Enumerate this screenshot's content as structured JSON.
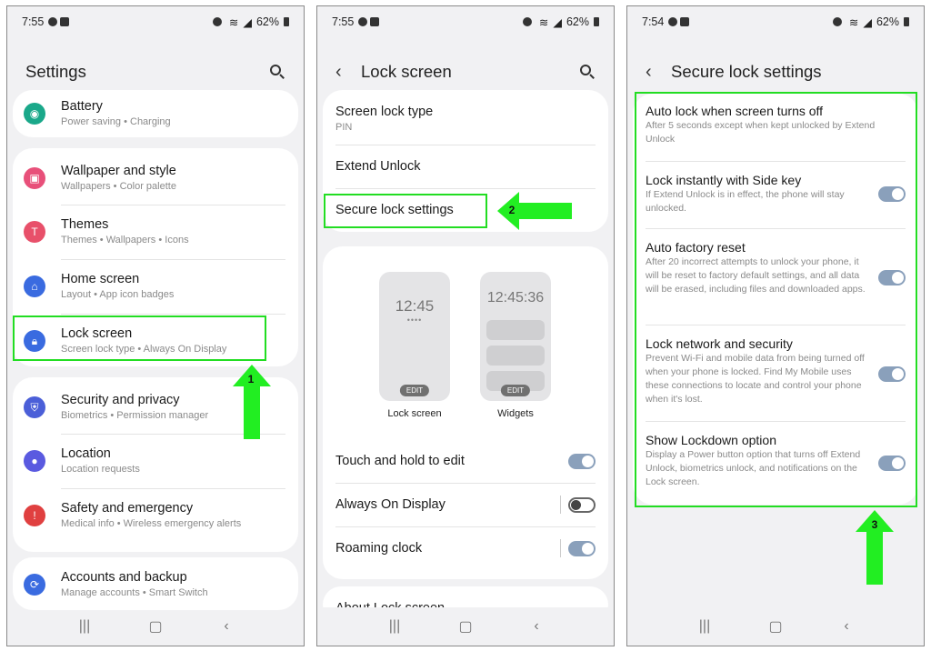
{
  "screens": [
    {
      "time": "7:55",
      "battery": "62%",
      "title": "Settings",
      "items": [
        {
          "title": "Battery",
          "sub": "Power saving  •  Charging"
        },
        {
          "title": "Wallpaper and style",
          "sub": "Wallpapers  •  Color palette"
        },
        {
          "title": "Themes",
          "sub": "Themes  •  Wallpapers  •  Icons"
        },
        {
          "title": "Home screen",
          "sub": "Layout  •  App icon badges"
        },
        {
          "title": "Lock screen",
          "sub": "Screen lock type  •  Always On Display"
        },
        {
          "title": "Security and privacy",
          "sub": "Biometrics  •  Permission manager"
        },
        {
          "title": "Location",
          "sub": "Location requests"
        },
        {
          "title": "Safety and emergency",
          "sub": "Medical info  •  Wireless emergency alerts"
        },
        {
          "title": "Accounts and backup",
          "sub": "Manage accounts  •  Smart Switch"
        }
      ],
      "step": "1"
    },
    {
      "time": "7:55",
      "battery": "62%",
      "title": "Lock screen",
      "screen_lock_type": "Screen lock type",
      "screen_lock_value": "PIN",
      "extend_unlock": "Extend Unlock",
      "secure_lock": "Secure lock settings",
      "preview_clock1": "12:45",
      "preview_dots": "••••",
      "preview_clock2": "12:45:36",
      "edit": "EDIT",
      "preview_label1": "Lock screen",
      "preview_label2": "Widgets",
      "touch_hold": "Touch and hold to edit",
      "aod": "Always On Display",
      "roaming": "Roaming clock",
      "about": "About Lock screen",
      "step": "2"
    },
    {
      "time": "7:54",
      "battery": "62%",
      "title": "Secure lock settings",
      "items": [
        {
          "title": "Auto lock when screen turns off",
          "sub": "After 5 seconds except when kept unlocked by Extend Unlock"
        },
        {
          "title": "Lock instantly with Side key",
          "sub": "If Extend Unlock is in effect, the phone will stay unlocked."
        },
        {
          "title": "Auto factory reset",
          "sub": "After 20 incorrect attempts to unlock your phone, it will be reset to factory default settings, and all data will be erased, including files and downloaded apps."
        },
        {
          "title": "Lock network and security",
          "sub": "Prevent Wi-Fi and mobile data from being turned off when your phone is locked. Find My Mobile uses these connections to locate and control your phone when it's lost."
        },
        {
          "title": "Show Lockdown option",
          "sub": "Display a Power button option that turns off Extend Unlock, biometrics unlock, and notifications on the Lock screen."
        }
      ],
      "step": "3"
    }
  ],
  "colors": {
    "highlight": "#22dd22",
    "arrow": "#22ee22",
    "toggle_on": "#8aa0bb"
  }
}
